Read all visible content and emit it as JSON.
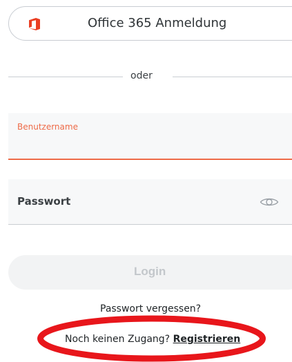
{
  "office_login": {
    "label": "Office 365 Anmeldung",
    "icon": "office-365-icon",
    "icon_color": "#ea3e23"
  },
  "divider": {
    "text": "oder"
  },
  "username": {
    "label": "Benutzername",
    "value": "",
    "accent_color": "#ee6a47"
  },
  "password": {
    "label": "Passwort",
    "value": "",
    "toggle_icon": "eye-icon"
  },
  "login": {
    "label": "Login"
  },
  "forgot": {
    "text": "Passwort vergessen?"
  },
  "register": {
    "prompt": "Noch keinen Zugang?",
    "link": "Registrieren"
  },
  "annotation": {
    "shape": "red-ellipse",
    "color": "#e8161b"
  }
}
